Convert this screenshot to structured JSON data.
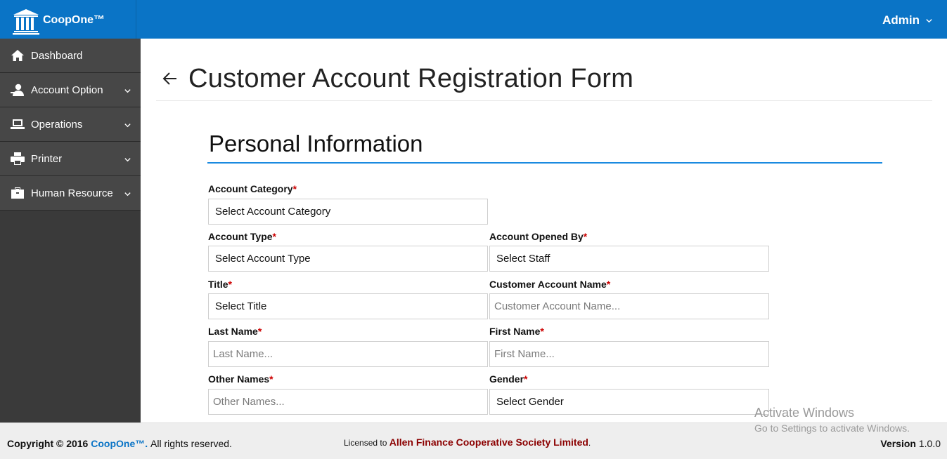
{
  "app": {
    "name": "CoopOne™"
  },
  "user": {
    "name": "Admin"
  },
  "sidebar": {
    "items": [
      {
        "label": "Dashboard",
        "icon": "home-icon"
      },
      {
        "label": "Account Option",
        "icon": "user-icon"
      },
      {
        "label": "Operations",
        "icon": "laptop-icon"
      },
      {
        "label": "Printer",
        "icon": "printer-icon"
      },
      {
        "label": "Human Resource",
        "icon": "briefcase-icon"
      }
    ]
  },
  "page": {
    "title": "Customer Account Registration Form"
  },
  "section": {
    "title": "Personal Information"
  },
  "form": {
    "account_category": {
      "label": "Account Category",
      "value": "Select Account Category"
    },
    "account_type": {
      "label": "Account Type",
      "value": "Select Account Type"
    },
    "account_opened_by": {
      "label": "Account Opened By",
      "value": "Select Staff"
    },
    "title": {
      "label": "Title",
      "value": "Select Title"
    },
    "customer_account_name": {
      "label": "Customer Account Name",
      "placeholder": "Customer Account Name..."
    },
    "last_name": {
      "label": "Last Name",
      "placeholder": "Last Name..."
    },
    "first_name": {
      "label": "First Name",
      "placeholder": "First Name..."
    },
    "other_names": {
      "label": "Other Names",
      "placeholder": "Other Names..."
    },
    "gender": {
      "label": "Gender",
      "value": "Select Gender"
    },
    "required_mark": "*"
  },
  "footer": {
    "copyright_prefix": "Copyright © 2016",
    "brand": "CoopOne™.",
    "rights": "All rights reserved.",
    "licensed_to_label": "Licensed to",
    "licensee": "Allen Finance Cooperative Society Limited",
    "licensee_suffix": ".",
    "version_label": "Version",
    "version_value": "1.0.0"
  },
  "watermark": {
    "line1": "Activate Windows",
    "line2": "Go to Settings to activate Windows."
  },
  "colors": {
    "topbar": "#0a74c6",
    "sidebar": "#474747",
    "accent_rule": "#1a8ae0",
    "required": "#cc0000",
    "licensee": "#8b0000"
  }
}
